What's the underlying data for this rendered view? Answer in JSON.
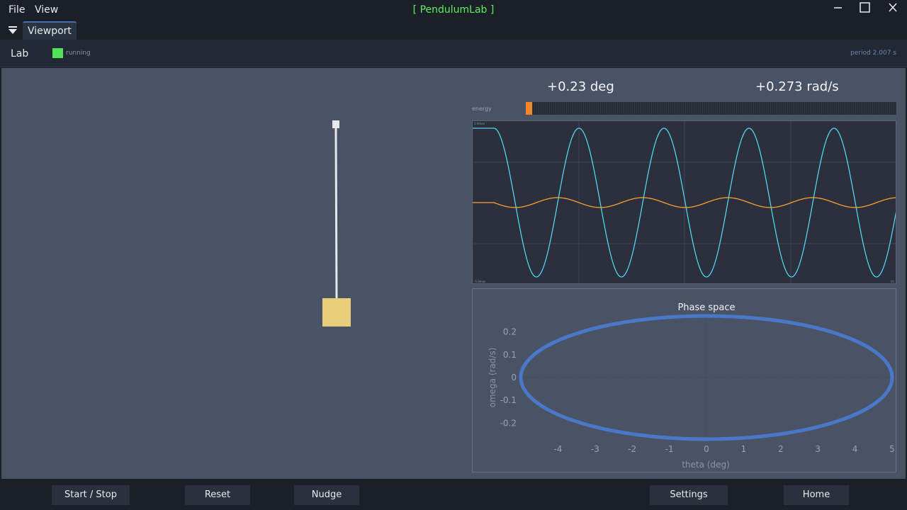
{
  "menu": {
    "file": "File",
    "view": "View"
  },
  "app_title": "[ PendulumLab ]",
  "tabs": {
    "viewport": "Viewport"
  },
  "lab": {
    "label": "Lab",
    "status": "running",
    "period": "period 2.007 s"
  },
  "readouts": {
    "angle": "+0.23 deg",
    "angular_velocity": "+0.273 rad/s"
  },
  "energy": {
    "label": "energy",
    "fraction": 0.018
  },
  "waveform": {
    "top_left": "5 θmax",
    "bottom_left": "-5 θmax",
    "bottom_right": "t/s"
  },
  "chart_data": {
    "type": "scatter",
    "title": "Phase space",
    "xlabel": "theta (deg)",
    "ylabel": "omega (rad/s)",
    "xlim": [
      -5,
      5
    ],
    "ylim": [
      -0.27,
      0.27
    ],
    "xticks": [
      -4,
      -3,
      -2,
      -1,
      0,
      1,
      2,
      3,
      4,
      5
    ],
    "yticks": [
      0.2,
      0.1,
      0,
      -0.1,
      -0.2
    ],
    "xtick_labels": [
      "-4",
      "-3",
      "-2",
      "-1",
      "0",
      "1",
      "2",
      "3",
      "4",
      "5"
    ],
    "ytick_labels": [
      "0.2",
      "0.1",
      "0",
      "-0.1",
      "-0.2"
    ],
    "series": [
      {
        "shape": "ellipse",
        "theta_amplitude": 5,
        "omega_amplitude": 0.27
      }
    ],
    "grid": false,
    "color": "#4a78c8"
  },
  "buttons": {
    "start_stop": "Start / Stop",
    "reset": "Reset",
    "nudge": "Nudge",
    "settings": "Settings",
    "home": "Home"
  },
  "colors": {
    "accent": "#5cf05c",
    "running": "#50e35a",
    "energy": "#f5862a",
    "theta_wave": "#4fd4f2",
    "omega_wave": "#f5a23a",
    "bob": "#e8cf7a"
  }
}
